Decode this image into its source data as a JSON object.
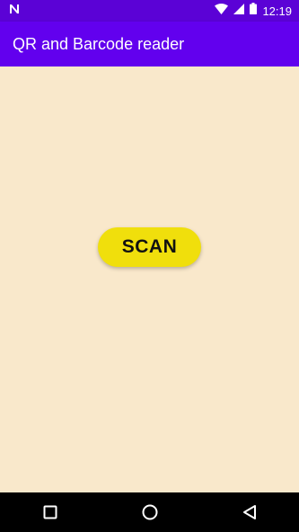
{
  "status_bar": {
    "time": "12:19",
    "icons": [
      "notification-n-icon",
      "wifi-icon",
      "cellular-signal-icon",
      "battery-icon"
    ]
  },
  "app_bar": {
    "title": "QR and Barcode reader",
    "color": "#6200ee"
  },
  "main": {
    "scan_button_label": "SCAN",
    "background_color": "#f9e8cb",
    "button_color": "#f0df0c"
  },
  "nav_bar": {
    "icons": [
      "recents-square-icon",
      "home-circle-icon",
      "back-triangle-icon"
    ]
  }
}
